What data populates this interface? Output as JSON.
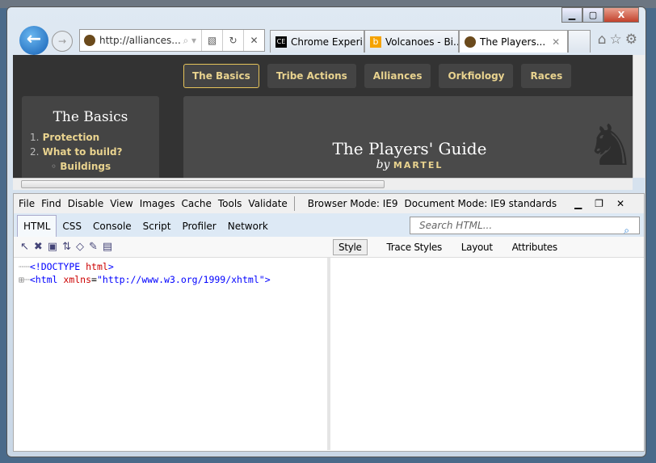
{
  "browser": {
    "address": "http://alliances...",
    "tabs": [
      {
        "label": "Chrome Experi...",
        "icon": "CE",
        "color": "#000000"
      },
      {
        "label": "Volcanoes - Bi...",
        "icon": "b",
        "color": "#f5a300"
      },
      {
        "label": "The Players...",
        "active": true
      }
    ]
  },
  "page": {
    "nav": [
      "The Basics",
      "Tribe Actions",
      "Alliances",
      "Orkfiology",
      "Races"
    ],
    "selected_nav": "The Basics",
    "sidebar": {
      "title": "The Basics",
      "items": [
        {
          "num": "1.",
          "label": "Protection"
        },
        {
          "num": "2.",
          "label": "What to build?"
        },
        {
          "num": "◦",
          "label": "Buildings"
        }
      ]
    },
    "hero": {
      "title": "The Players' Guide",
      "by": "by",
      "author": "MARTEL"
    },
    "accent": "#e9d38f"
  },
  "devtools": {
    "menu": [
      "File",
      "Find",
      "Disable",
      "View",
      "Images",
      "Cache",
      "Tools",
      "Validate"
    ],
    "browser_mode": "Browser Mode: IE9",
    "document_mode": "Document Mode: IE9 standards",
    "tabs": [
      "HTML",
      "CSS",
      "Console",
      "Script",
      "Profiler",
      "Network"
    ],
    "search_placeholder": "Search HTML...",
    "right_tabs": [
      "Style",
      "Trace Styles",
      "Layout",
      "Attributes"
    ],
    "tree": {
      "doctype_open": "<!DOCTYPE ",
      "doctype_kw": "html",
      "doctype_close": ">",
      "html_open": "<html ",
      "attr": "xmlns",
      "eq": "=",
      "val": "\"http://www.w3.org/1999/xhtml\"",
      "close": ">"
    }
  }
}
